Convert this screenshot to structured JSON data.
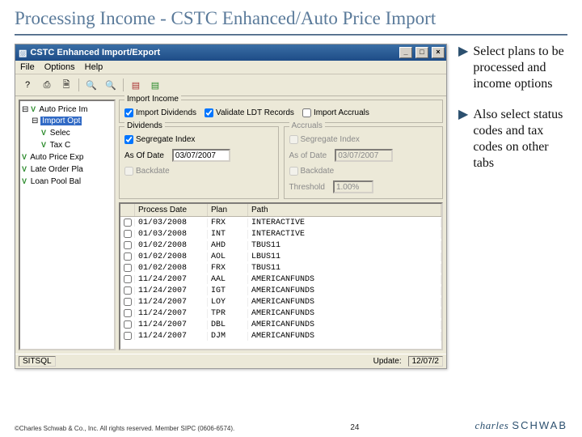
{
  "slide": {
    "title": "Processing Income - CSTC Enhanced/Auto Price Import",
    "page_number": "24",
    "copyright": "©Charles Schwab & Co., Inc. All rights reserved. Member SIPC (0606-6574).",
    "logo_italic": "charles",
    "logo_caps": "SCHWAB"
  },
  "window": {
    "title": "CSTC Enhanced Import/Export",
    "menus": {
      "file": "File",
      "options": "Options",
      "help": "Help"
    },
    "icons": [
      "help-icon",
      "print-icon",
      "doc-icon",
      "sep",
      "search-red-icon",
      "search-green-icon",
      "sep",
      "db-red-icon",
      "db-green-icon"
    ],
    "status_left": "SITSQL",
    "status_right_label": "Update:",
    "status_right_val": "12/07/2"
  },
  "tree": {
    "items": [
      {
        "lvl": 0,
        "exp": "-",
        "v": "V",
        "label": "Auto Price Im"
      },
      {
        "lvl": 1,
        "exp": "-",
        "v": "",
        "label": "Import Opt",
        "sel": true
      },
      {
        "lvl": 2,
        "exp": "",
        "v": "V",
        "label": "Selec"
      },
      {
        "lvl": 2,
        "exp": "",
        "v": "V",
        "label": "Tax C"
      },
      {
        "lvl": 0,
        "exp": "",
        "v": "V",
        "label": "Auto Price Exp"
      },
      {
        "lvl": 0,
        "exp": "",
        "v": "V",
        "label": "Late Order Pla"
      },
      {
        "lvl": 0,
        "exp": "",
        "v": "V",
        "label": "Loan Pool Bal"
      }
    ]
  },
  "import_income": {
    "title": "Import Income",
    "dividends": "Import Dividends",
    "validate": "Validate LDT Records",
    "accruals": "Import Accruals"
  },
  "dividends": {
    "title": "Dividends",
    "segregate": "Segregate Index",
    "asof_label": "As Of Date",
    "asof_value": "03/07/2007",
    "backdate": "Backdate"
  },
  "accruals": {
    "title": "Accruals",
    "segregate": "Segregate Index",
    "asof_label": "As of Date",
    "asof_value": "03/07/2007",
    "backdate": "Backdate",
    "threshold_label": "Threshold",
    "threshold_value": "1.00%"
  },
  "table": {
    "headers": {
      "date": "Process Date",
      "plan": "Plan",
      "path": "Path"
    },
    "rows": [
      {
        "date": "01/03/2008",
        "plan": "FRX",
        "path": "INTERACTIVE"
      },
      {
        "date": "01/03/2008",
        "plan": "INT",
        "path": "INTERACTIVE"
      },
      {
        "date": "01/02/2008",
        "plan": "AHD",
        "path": "TBUS11"
      },
      {
        "date": "01/02/2008",
        "plan": "AOL",
        "path": "LBUS11"
      },
      {
        "date": "01/02/2008",
        "plan": "FRX",
        "path": "TBUS11"
      },
      {
        "date": "11/24/2007",
        "plan": "AAL",
        "path": "AMERICANFUNDS"
      },
      {
        "date": "11/24/2007",
        "plan": "IGT",
        "path": "AMERICANFUNDS"
      },
      {
        "date": "11/24/2007",
        "plan": "LOY",
        "path": "AMERICANFUNDS"
      },
      {
        "date": "11/24/2007",
        "plan": "TPR",
        "path": "AMERICANFUNDS"
      },
      {
        "date": "11/24/2007",
        "plan": "DBL",
        "path": "AMERICANFUNDS"
      },
      {
        "date": "11/24/2007",
        "plan": "DJM",
        "path": "AMERICANFUNDS"
      }
    ]
  },
  "bullets": {
    "b1": "Select plans to be processed and income options",
    "b2": "Also select status codes and tax codes on other tabs"
  }
}
